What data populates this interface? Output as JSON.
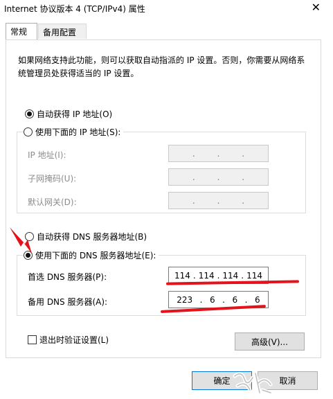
{
  "window": {
    "title": "Internet 协议版本 4 (TCP/IPv4) 属性",
    "close_icon": "close-icon"
  },
  "tabs": [
    {
      "label": "常规",
      "active": true
    },
    {
      "label": "备用配置",
      "active": false
    }
  ],
  "description": "如果网络支持此功能，则可以获取自动指派的 IP 设置。否则，你需要从网络系统管理员处获得适当的 IP 设置。",
  "ip_section": {
    "auto_label": "自动获得 IP 地址(O)",
    "auto_selected": true,
    "manual_label": "使用下面的 IP 地址(S):",
    "manual_selected": false,
    "fields": [
      {
        "label": "IP 地址(I):",
        "value": [
          "",
          "",
          "",
          ""
        ]
      },
      {
        "label": "子网掩码(U):",
        "value": [
          "",
          "",
          "",
          ""
        ]
      },
      {
        "label": "默认网关(D):",
        "value": [
          "",
          "",
          "",
          ""
        ]
      }
    ]
  },
  "dns_section": {
    "auto_label": "自动获得 DNS 服务器地址(B)",
    "auto_selected": false,
    "manual_label": "使用下面的 DNS 服务器地址(E):",
    "manual_selected": true,
    "preferred": {
      "label": "首选 DNS 服务器(P):",
      "octets": [
        "114",
        "114",
        "114",
        "114"
      ]
    },
    "alternate": {
      "label": "备用 DNS 服务器(A):",
      "octets": [
        "223",
        "6",
        "6",
        "6"
      ]
    }
  },
  "validate_on_exit": {
    "label": "退出时验证设置(L)",
    "checked": false
  },
  "buttons": {
    "advanced": "高级(V)...",
    "ok": "确定",
    "cancel": "取消"
  },
  "annotation_color": "#e3121b"
}
